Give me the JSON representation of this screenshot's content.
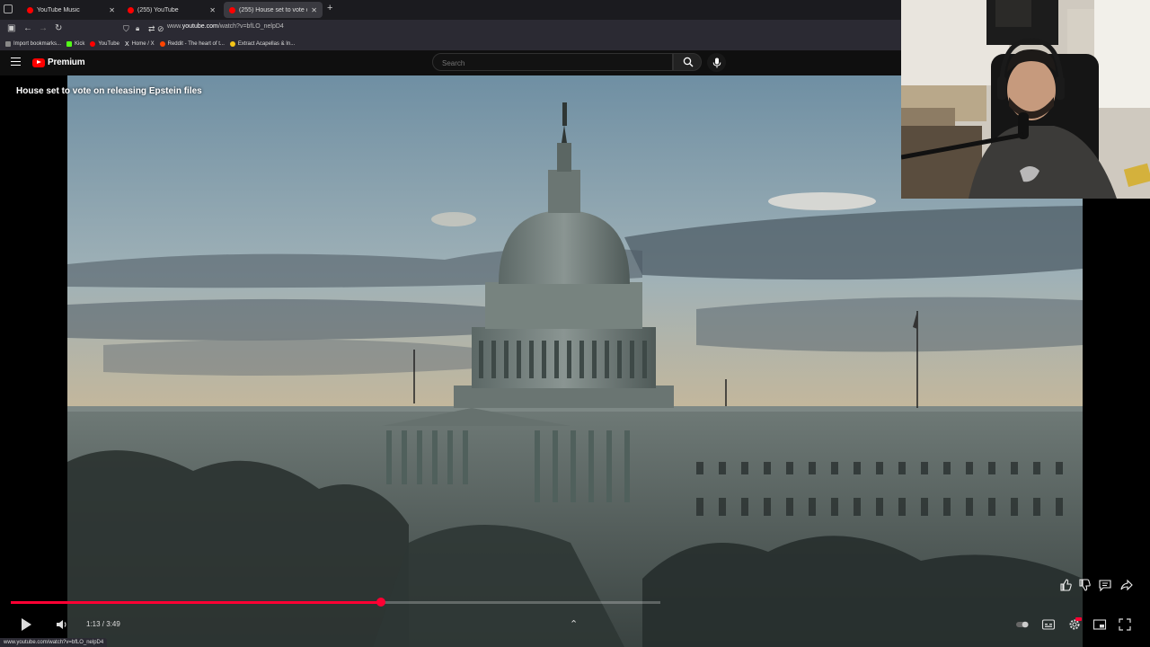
{
  "browser": {
    "tabs": [
      {
        "title": "YouTube Music",
        "color": "#ff0000"
      },
      {
        "title": "(255) YouTube",
        "color": "#ff0000"
      },
      {
        "title": "(255) House set to vote on rele...",
        "color": "#ff0000"
      }
    ],
    "url_prefix": "www.",
    "url_domain": "youtube.com",
    "url_path": "/watch?v=bfLO_nelpD4",
    "bookmarks": [
      {
        "label": "Import bookmarks...",
        "color": "#888888"
      },
      {
        "label": "Kick",
        "color": "#53fc18"
      },
      {
        "label": "YouTube",
        "color": "#ff0000"
      },
      {
        "label": "Home / X",
        "color": "#ffffff"
      },
      {
        "label": "Reddit - The heart of t...",
        "color": "#ff4500"
      },
      {
        "label": "Extract Acapellas & In...",
        "color": "#f5c518"
      }
    ],
    "status_url": "www.youtube.com/watch?v=bfLO_nelpD4"
  },
  "youtube": {
    "logo_text": "Premium",
    "search_placeholder": "Search"
  },
  "video": {
    "title": "House set to vote on releasing Epstein files",
    "time_display": "1:13 / 3:49",
    "progress_fraction": 0.5699,
    "accent": "#ff0033"
  },
  "icons": [
    "menu-icon",
    "search-icon",
    "mic-icon",
    "play-icon",
    "volume-icon",
    "chevron-up-icon",
    "like-icon",
    "dislike-icon",
    "comment-icon",
    "share-icon",
    "autoplay-toggle-icon",
    "captions-icon",
    "settings-icon",
    "miniplayer-icon",
    "fullscreen-icon"
  ]
}
